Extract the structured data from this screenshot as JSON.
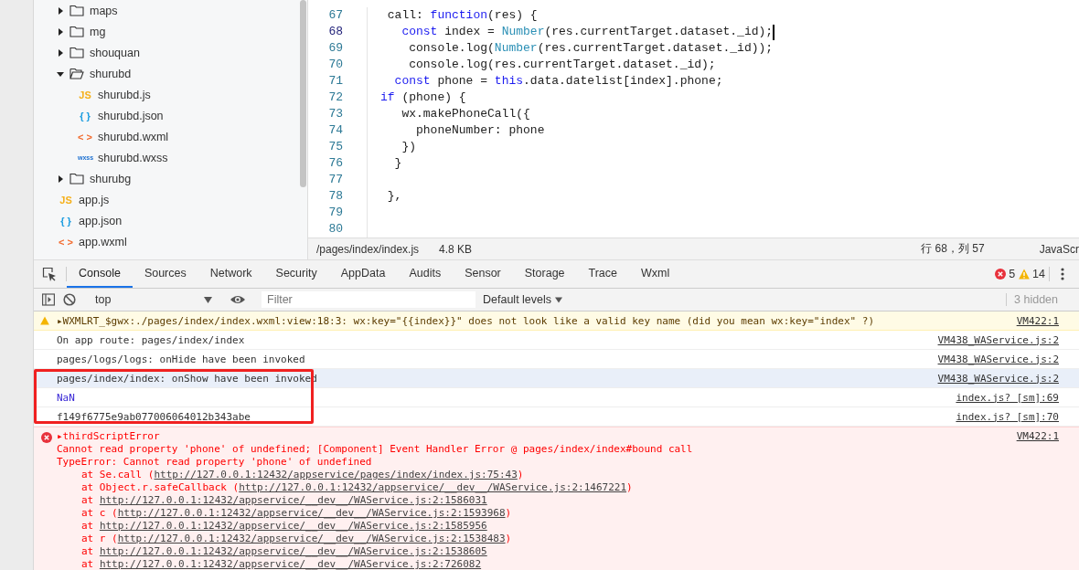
{
  "file_tree": [
    {
      "kind": "folder",
      "label": "maps",
      "expanded": false
    },
    {
      "kind": "folder",
      "label": "mg",
      "expanded": false
    },
    {
      "kind": "folder",
      "label": "shouquan",
      "expanded": false
    },
    {
      "kind": "folder",
      "label": "shurubd",
      "expanded": true,
      "children": [
        {
          "kind": "js",
          "icon": "JS",
          "label": "shurubd.js"
        },
        {
          "kind": "json",
          "icon": "{ }",
          "label": "shurubd.json"
        },
        {
          "kind": "wxml",
          "icon": "< >",
          "label": "shurubd.wxml"
        },
        {
          "kind": "wxss",
          "icon": "wxss",
          "label": "shurubd.wxss"
        }
      ]
    },
    {
      "kind": "folder",
      "label": "shurubg",
      "expanded": false
    },
    {
      "kind": "js",
      "icon": "JS",
      "label": "app.js"
    },
    {
      "kind": "json",
      "icon": "{ }",
      "label": "app.json"
    },
    {
      "kind": "wxml",
      "icon": "< >",
      "label": "app.wxml"
    }
  ],
  "editor": {
    "lines": [
      {
        "number": "67",
        "active": false,
        "tokens": [
          {
            "kind": "plain",
            "text": " call: "
          },
          {
            "kind": "keyword",
            "text": "function"
          },
          {
            "kind": "plain",
            "text": "(res) {"
          }
        ]
      },
      {
        "number": "68",
        "active": true,
        "tokens": [
          {
            "kind": "keyword",
            "text": "   const"
          },
          {
            "kind": "plain",
            "text": " index = "
          },
          {
            "kind": "builtin",
            "text": "Number"
          },
          {
            "kind": "plain",
            "text": "(res.currentTarget.dataset._id);"
          }
        ]
      },
      {
        "number": "69",
        "active": false,
        "tokens": [
          {
            "kind": "plain",
            "text": "    console.log("
          },
          {
            "kind": "builtin",
            "text": "Number"
          },
          {
            "kind": "plain",
            "text": "(res.currentTarget.dataset._id));"
          }
        ]
      },
      {
        "number": "70",
        "active": false,
        "tokens": [
          {
            "kind": "plain",
            "text": "    console.log(res.currentTarget.dataset._id);"
          }
        ]
      },
      {
        "number": "71",
        "active": false,
        "tokens": [
          {
            "kind": "keyword",
            "text": "  const"
          },
          {
            "kind": "plain",
            "text": " phone = "
          },
          {
            "kind": "keyword",
            "text": "this"
          },
          {
            "kind": "plain",
            "text": ".data.datelist[index].phone;"
          }
        ]
      },
      {
        "number": "72",
        "active": false,
        "tokens": [
          {
            "kind": "keyword",
            "text": "if"
          },
          {
            "kind": "plain",
            "text": " (phone) {"
          }
        ]
      },
      {
        "number": "73",
        "active": false,
        "tokens": [
          {
            "kind": "plain",
            "text": "   wx.makePhoneCall({"
          }
        ]
      },
      {
        "number": "74",
        "active": false,
        "tokens": [
          {
            "kind": "plain",
            "text": "     phoneNumber: phone"
          }
        ]
      },
      {
        "number": "75",
        "active": false,
        "tokens": [
          {
            "kind": "plain",
            "text": "   })"
          }
        ]
      },
      {
        "number": "76",
        "active": false,
        "tokens": [
          {
            "kind": "plain",
            "text": "  }"
          }
        ]
      },
      {
        "number": "77",
        "active": false
      },
      {
        "number": "78",
        "active": false,
        "tokens": [
          {
            "kind": "plain",
            "text": " },"
          }
        ]
      },
      {
        "number": "79",
        "active": false
      },
      {
        "number": "80",
        "active": false
      }
    ]
  },
  "status_bar": {
    "path": "/pages/index/index.js",
    "size": "4.8 KB",
    "position": "行 68，列 57",
    "language": "JavaScr"
  },
  "devtools": {
    "tabs": [
      {
        "label": "Console",
        "selected": true
      },
      {
        "label": "Sources",
        "selected": false
      },
      {
        "label": "Network",
        "selected": false
      },
      {
        "label": "Security",
        "selected": false
      },
      {
        "label": "AppData",
        "selected": false
      },
      {
        "label": "Audits",
        "selected": false
      },
      {
        "label": "Sensor",
        "selected": false
      },
      {
        "label": "Storage",
        "selected": false
      },
      {
        "label": "Trace",
        "selected": false
      },
      {
        "label": "Wxml",
        "selected": false
      }
    ],
    "error_count": "5",
    "warning_count": "14",
    "context": "top",
    "filter_placeholder": "Filter",
    "levels": "Default levels",
    "hidden_count": "3 hidden",
    "messages": [
      {
        "kind": "warning",
        "text": "▸WXMLRT_$gwx:./pages/index/index.wxml:view:18:3: wx:key=\"{{index}}\" does not look like a valid key name (did you mean wx:key=\"index\" ?)",
        "source": "VM422:1",
        "highlighted": false
      },
      {
        "kind": "log",
        "text": "On app route: pages/index/index",
        "source": "VM438_WAService.js:2",
        "highlighted": false
      },
      {
        "kind": "log",
        "text": "pages/logs/logs: onHide have been invoked",
        "source": "VM438_WAService.js:2",
        "highlighted": false
      },
      {
        "kind": "log",
        "text": "pages/index/index: onShow have been invoked",
        "source": "VM438_WAService.js:2",
        "highlighted": true
      },
      {
        "kind": "number",
        "text": "NaN",
        "source": "index.js? [sm]:69",
        "highlighted": false
      },
      {
        "kind": "log",
        "text": "f149f6775e9ab077006064012b343abe",
        "source": "index.js? [sm]:70",
        "highlighted": false
      }
    ],
    "error": {
      "title": "▸thirdScriptError",
      "source": "VM422:1",
      "lines": [
        "Cannot read property 'phone' of undefined; [Component] Event Handler Error @ pages/index/index#bound call",
        "TypeError: Cannot read property 'phone' of undefined"
      ],
      "stack": [
        {
          "prefix": "at Se.call (",
          "link": "http://127.0.0.1:12432/appservice/pages/index/index.js:75:43",
          "suffix": ")"
        },
        {
          "prefix": "at Object.r.safeCallback (",
          "link": "http://127.0.0.1:12432/appservice/__dev__/WAService.js:2:1467221",
          "suffix": ")"
        },
        {
          "prefix": "at ",
          "link": "http://127.0.0.1:12432/appservice/__dev__/WAService.js:2:1586031"
        },
        {
          "prefix": "at c (",
          "link": "http://127.0.0.1:12432/appservice/__dev__/WAService.js:2:1593968",
          "suffix": ")"
        },
        {
          "prefix": "at ",
          "link": "http://127.0.0.1:12432/appservice/__dev__/WAService.js:2:1585956"
        },
        {
          "prefix": "at r (",
          "link": "http://127.0.0.1:12432/appservice/__dev__/WAService.js:2:1538483",
          "suffix": ")"
        },
        {
          "prefix": "at ",
          "link": "http://127.0.0.1:12432/appservice/__dev__/WAService.js:2:1538605"
        },
        {
          "prefix": "at ",
          "link": "http://127.0.0.1:12432/appservice/__dev__/WAService.js:2:726082"
        }
      ]
    }
  }
}
